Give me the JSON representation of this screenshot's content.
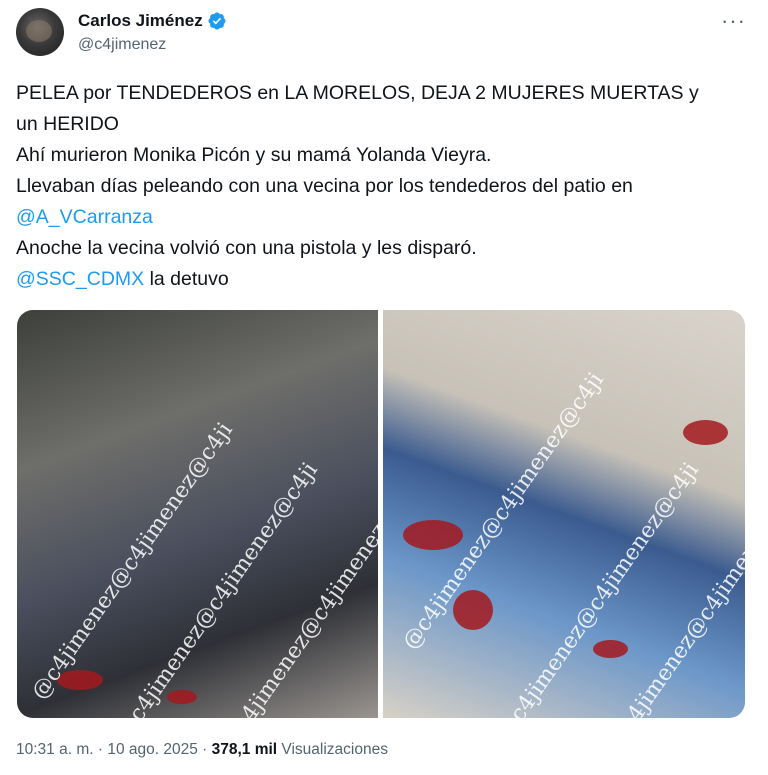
{
  "author": {
    "display_name": "Carlos Jiménez",
    "handle": "@c4jimenez"
  },
  "more_label": "···",
  "tweet": {
    "line1": "PELEA por TENDEDEROS en LA MORELOS, DEJA 2 MUJERES MUERTAS y",
    "line2": "un HERIDO",
    "line3": "Ahí murieron Monika Picón y su mamá Yolanda Vieyra.",
    "line4": "Llevaban días peleando con una vecina por los tendederos del patio en",
    "mention1": "@A_VCarranza",
    "line6": "Anoche la vecina volvió con una pistola y les disparó.",
    "mention2": "@SSC_CDMX",
    "line7_rest": " la detuvo"
  },
  "media": {
    "watermark": "@c4jimenez@c4jimenez@c4ji"
  },
  "meta": {
    "time": "10:31 a. m.",
    "sep": " · ",
    "date": "10 ago. 2025",
    "views_count": "378,1 mil",
    "views_label": " Visualizaciones"
  },
  "colors": {
    "link": "#1d9bf0",
    "verified": "#1d9bf0",
    "secondary_text": "#536471"
  }
}
